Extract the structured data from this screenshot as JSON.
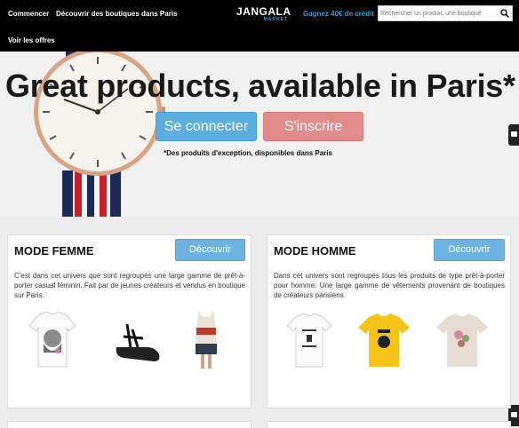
{
  "nav": {
    "commencer": "Commencer",
    "decouvrir": "Découvrir des boutiques dans Paris",
    "offres": "Voir les offres",
    "logo_main": "JANGALA",
    "logo_sub": "MARKET",
    "credit": "Gagnez 40€ de crédit",
    "search_placeholder": "Rechercher un produit, une boutique"
  },
  "hero": {
    "title": "Great products, available in Paris*",
    "connect_label": "Se connecter",
    "register_label": "S'inscrire",
    "tagline": "*Des produits d'exception, disponibles dans Paris"
  },
  "cards": {
    "femme": {
      "title": "MODE FEMME",
      "button": "Découvrir",
      "description": "C'est dans cet univers que sont regroupés une large gamme de prêt-à-porter casual féminin. Fait par de jeunes créateurs et vendus en boutique sur Paris."
    },
    "homme": {
      "title": "MODE HOMME",
      "button": "Découvrir",
      "description": "Dans cet univers sont regroupés tous les produits de type prêt-à-porter pour homme. Une large gamme de vêtements provenant de boutiques de créateurs parisiens."
    }
  },
  "colors": {
    "accent_blue": "#5aaee0",
    "accent_pink": "#e28b8b",
    "credit_blue": "#2ba0e0"
  }
}
